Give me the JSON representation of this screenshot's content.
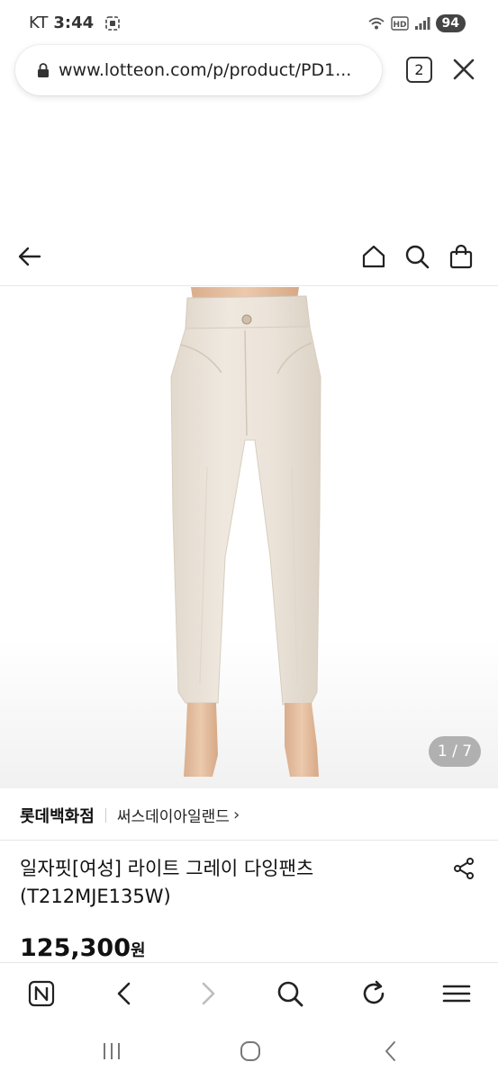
{
  "status_bar": {
    "carrier": "KT",
    "time": "3:44",
    "battery": "94",
    "icons": [
      "screen-record-icon",
      "wifi-icon",
      "hd-icon",
      "signal-icon"
    ]
  },
  "browser": {
    "url": "www.lotteon.com/p/product/PD1...",
    "tab_count": "2",
    "icons": [
      "lock-icon",
      "close-icon"
    ]
  },
  "app_nav": {
    "icons": [
      "back-arrow-icon",
      "home-icon",
      "search-icon",
      "cart-icon"
    ]
  },
  "product": {
    "image_counter": "1 / 7",
    "store": "롯데백화점",
    "brand": "써스데이아일랜드",
    "brand_chevron": "›",
    "title_line1": "일자핏[여성] 라이트 그레이 다잉팬츠",
    "title_line2": "(T212MJE135W)",
    "price": "125,300",
    "currency": "원",
    "image_description": "light gray straight fit women's pants on mannequin"
  },
  "browser_toolbar": {
    "icons": [
      "naver-n-icon",
      "back-icon",
      "forward-icon",
      "search-icon",
      "refresh-icon",
      "menu-icon"
    ]
  },
  "android_nav": {
    "icons": [
      "recents-icon",
      "home-circle-icon",
      "back-chevron-icon"
    ]
  },
  "colors": {
    "pants": "#eee6dc",
    "pants_shadow": "#dcd3c7",
    "skin": "#e6c2a6",
    "disabled_icon": "#bdbdbd"
  }
}
